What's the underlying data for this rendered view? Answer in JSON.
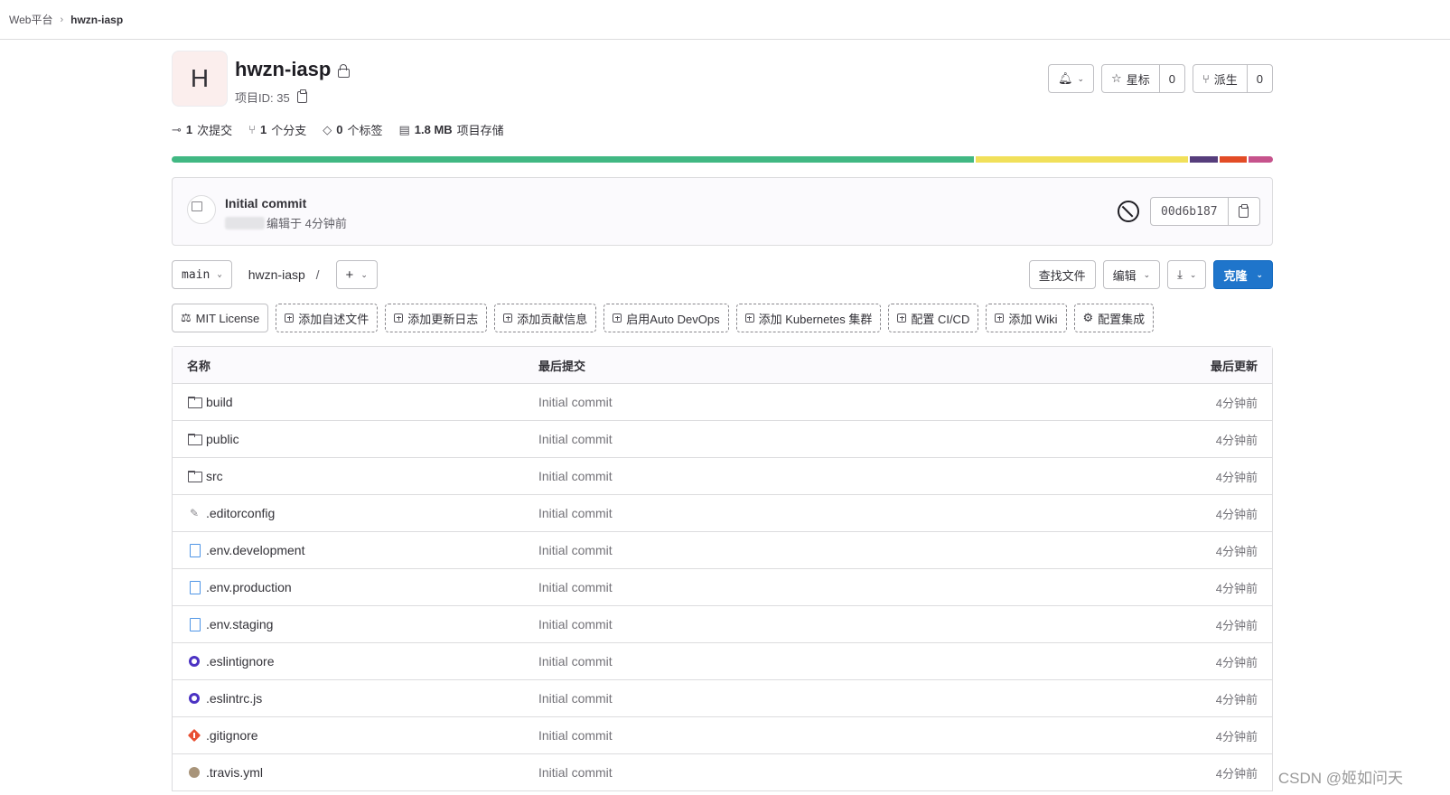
{
  "breadcrumb": {
    "root": "Web平台",
    "sep": "›",
    "current": "hwzn-iasp"
  },
  "project": {
    "avatar_letter": "H",
    "name": "hwzn-iasp",
    "id_label": "项目ID: 35",
    "notify_chev": "⌄",
    "star_label": "星标",
    "star_count": "0",
    "fork_label": "派生",
    "fork_count": "0"
  },
  "stats": {
    "commits_num": "1",
    "commits_label": "次提交",
    "branches_num": "1",
    "branches_label": "个分支",
    "tags_num": "0",
    "tags_label": "个标签",
    "storage_num": "1.8 MB",
    "storage_label": "项目存储"
  },
  "languages": [
    {
      "color": "#41b883",
      "pct": 73.3
    },
    {
      "color": "#f1e05a",
      "pct": 19.4
    },
    {
      "color": "#563d7c",
      "pct": 2.6
    },
    {
      "color": "#e34c26",
      "pct": 2.5
    },
    {
      "color": "#c6538c",
      "pct": 2.2
    }
  ],
  "commit": {
    "title": "Initial commit",
    "meta": "编辑于 4分钟前",
    "sha": "00d6b187"
  },
  "nav": {
    "branch": "main",
    "path": "hwzn-iasp",
    "slash": "/",
    "plus": "+",
    "find_file": "查找文件",
    "edit": "编辑",
    "download_icon": "⤓",
    "clone": "克隆"
  },
  "shortcuts": {
    "license": "MIT License",
    "readme": "添加自述文件",
    "changelog": "添加更新日志",
    "contributing": "添加贡献信息",
    "devops": "启用Auto DevOps",
    "kubernetes": "添加 Kubernetes 集群",
    "cicd": "配置 CI/CD",
    "wiki": "添加 Wiki",
    "integrations": "配置集成"
  },
  "table": {
    "headers": {
      "name": "名称",
      "last_commit": "最后提交",
      "last_update": "最后更新"
    },
    "rows": [
      {
        "name": "build",
        "commit": "Initial commit",
        "updated": "4分钟前"
      },
      {
        "name": "public",
        "commit": "Initial commit",
        "updated": "4分钟前"
      },
      {
        "name": "src",
        "commit": "Initial commit",
        "updated": "4分钟前"
      },
      {
        "name": ".editorconfig",
        "commit": "Initial commit",
        "updated": "4分钟前"
      },
      {
        "name": ".env.development",
        "commit": "Initial commit",
        "updated": "4分钟前"
      },
      {
        "name": ".env.production",
        "commit": "Initial commit",
        "updated": "4分钟前"
      },
      {
        "name": ".env.staging",
        "commit": "Initial commit",
        "updated": "4分钟前"
      },
      {
        "name": ".eslintignore",
        "commit": "Initial commit",
        "updated": "4分钟前"
      },
      {
        "name": ".eslintrc.js",
        "commit": "Initial commit",
        "updated": "4分钟前"
      },
      {
        "name": ".gitignore",
        "commit": "Initial commit",
        "updated": "4分钟前"
      },
      {
        "name": ".travis.yml",
        "commit": "Initial commit",
        "updated": "4分钟前"
      }
    ]
  },
  "watermark": "CSDN @姬如问天"
}
